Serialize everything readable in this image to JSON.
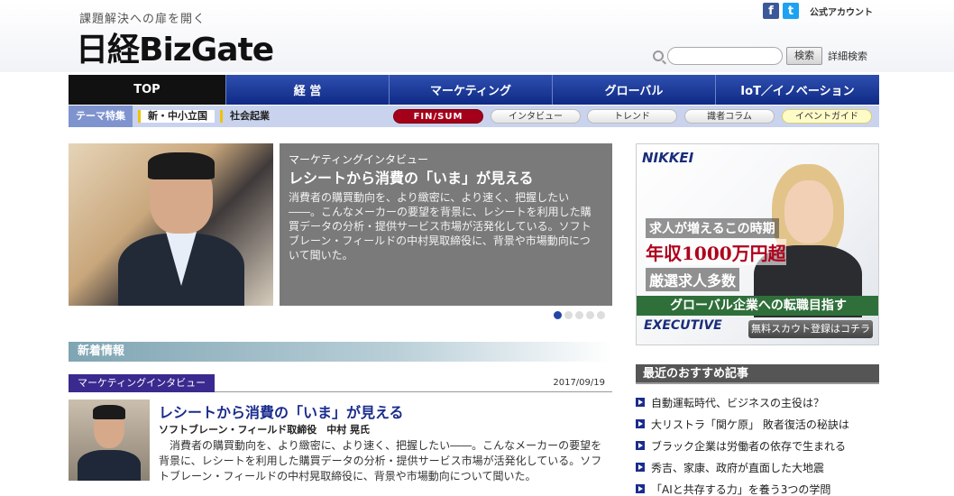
{
  "header": {
    "tagline": "課題解決への扉を開く",
    "logo_text": "日経BizGate",
    "social": {
      "facebook_glyph": "f",
      "twitter_glyph": "t",
      "label": "公式アカウント"
    },
    "search": {
      "placeholder": "",
      "button_label": "検索",
      "advanced_link": "詳細検索"
    }
  },
  "nav": {
    "items": [
      {
        "label": "TOP"
      },
      {
        "label": "経 営"
      },
      {
        "label": "マーケティング"
      },
      {
        "label": "グローバル"
      },
      {
        "label": "IoT／イノベーション"
      }
    ]
  },
  "subnav": {
    "theme_label": "テーマ特集",
    "themes": [
      {
        "label": "新・中小立国"
      },
      {
        "label": "社会起業"
      }
    ],
    "pills": [
      {
        "label": "FIN/SUM"
      },
      {
        "label": "インタビュー"
      },
      {
        "label": "トレンド"
      },
      {
        "label": "識者コラム"
      },
      {
        "label": "イベントガイド"
      }
    ]
  },
  "hero": {
    "kicker": "マーケティングインタビュー",
    "title": "レシートから消費の「いま」が見える",
    "body": "消費者の購買動向を、より緻密に、より速く、把握したい――。こんなメーカーの要望を背景に、レシートを利用した購買データの分析・提供サービス市場が活発化している。ソフトブレーン・フィールドの中村晃取締役に、背景や市場動向について聞いた。"
  },
  "news": {
    "heading": "新着情報",
    "category": "マーケティングインタビュー",
    "date": "2017/09/19",
    "article": {
      "title": "レシートから消費の「いま」が見える",
      "author": "ソフトブレーン・フィールド取締役　中村 晃氏",
      "body": "消費者の購買動向を、より緻密に、より速く、把握したい――。こんなメーカーの要望を背景に、レシートを利用した購買データの分析・提供サービス市場が活発化している。ソフトブレーン・フィールドの中村晃取締役に、背景や市場動向について聞いた。"
    }
  },
  "ad": {
    "brand": "NIKKEI",
    "line1": "求人が増えるこの時期",
    "line2": "年収1000万円超",
    "line3": "厳選求人多数",
    "line4": "グローバル企業への転職目指す",
    "exec": "EXECUTIVE",
    "cta": "無料スカウト登録はコチラ"
  },
  "recommended": {
    "heading": "最近のおすすめ記事",
    "items": [
      {
        "label": "自動運転時代、ビジネスの主役は？"
      },
      {
        "label": "大リストラ「関ケ原」 敗者復活の秘訣は"
      },
      {
        "label": "ブラック企業は労働者の依存で生まれる"
      },
      {
        "label": "秀吉、家康、政府が直面した大地震"
      },
      {
        "label": "「AIと共存する力」を養う3つの学問"
      }
    ]
  },
  "colors": {
    "nav_blue": "#1a3a9a",
    "finsum_red": "#a5001a",
    "news_category": "#3a2a8f",
    "article_title": "#1a2c8c"
  },
  "slider": {
    "active_index": 1,
    "count": 5
  }
}
